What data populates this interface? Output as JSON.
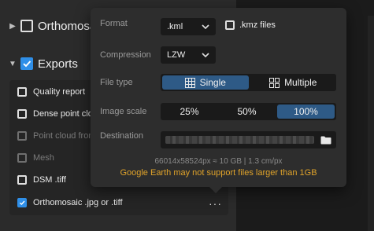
{
  "sidebar": {
    "orthomosaic_section_label": "Orthomosaic",
    "exports_section_label": "Exports",
    "items": [
      {
        "label": "Quality report"
      },
      {
        "label": "Dense point cloud"
      },
      {
        "label": "Point cloud from"
      },
      {
        "label": "Mesh"
      },
      {
        "label": "DSM .tiff"
      },
      {
        "label": "Orthomosaic .jpg or .tiff"
      }
    ],
    "more_button_label": "···"
  },
  "popover": {
    "format": {
      "label": "Format",
      "value": ".kml"
    },
    "kmz": {
      "label": ".kmz files"
    },
    "compression": {
      "label": "Compression",
      "value": "LZW"
    },
    "file_type": {
      "label": "File type",
      "options": [
        "Single",
        "Multiple"
      ],
      "selected": "Single"
    },
    "image_scale": {
      "label": "Image scale",
      "options": [
        "25%",
        "50%",
        "100%"
      ],
      "selected": "100%"
    },
    "destination": {
      "label": "Destination"
    },
    "info_text": "66014x58524px ≈ 10 GB | 1.3 cm/px",
    "warning_text": "Google Earth may not support files larger than 1GB"
  },
  "colors": {
    "accent": "#2f8fe8",
    "segment_active": "#2e5a86",
    "warning": "#e0a32a"
  }
}
